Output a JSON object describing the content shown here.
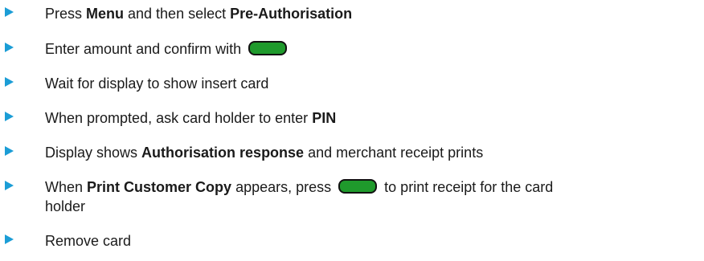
{
  "steps": [
    {
      "t1": "Press ",
      "b1": "Menu",
      "t2": " and then select ",
      "b2": "Pre-Authorisation"
    },
    {
      "t1": "Enter amount and confirm with",
      "key_icon": "green-confirm-key-icon"
    },
    {
      "t1": "Wait for display to show insert card"
    },
    {
      "t1": "When prompted, ask card holder to enter ",
      "b1": "PIN"
    },
    {
      "t1": "Display shows ",
      "b1": "Authorisation response",
      "t2": " and merchant receipt prints"
    },
    {
      "t1": "When ",
      "b1": "Print Customer Copy",
      "t2": " appears, press",
      "t3": "to print receipt for the card",
      "line2": "holder",
      "key_icon": "green-confirm-key-icon"
    },
    {
      "t1": "Remove card"
    }
  ],
  "colors": {
    "bullet": "#1b9dd6",
    "key_fill": "#1f9a2c",
    "text": "#1a1a1a"
  },
  "icons": {
    "bullet": "blue-triangle-bullet-icon",
    "key": "green-confirm-key-icon"
  }
}
